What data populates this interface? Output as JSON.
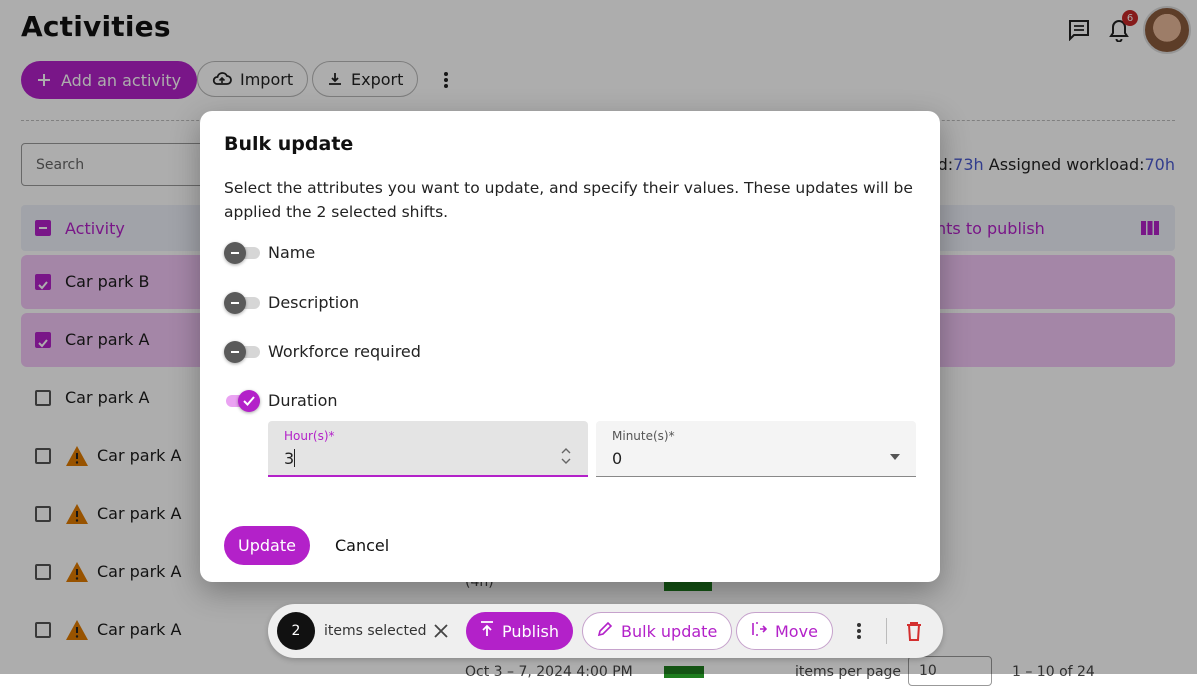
{
  "page": {
    "title": "Activities",
    "add_label": "Add an activity",
    "import_label": "Import",
    "export_label": "Export",
    "notification_count": "6",
    "search_placeholder": "Search",
    "workload_partial": "oad:",
    "workload_partial_value": "73h",
    "assigned_workload_label": "Assigned workload:",
    "assigned_workload_value": "70h",
    "header_activity": "Activity",
    "header_publish_partial": "nts to publish",
    "rows": [
      {
        "label": "Car park B",
        "checked": true,
        "warning": false
      },
      {
        "label": "Car park A",
        "checked": true,
        "warning": false
      },
      {
        "label": "Car park A",
        "checked": false,
        "warning": false
      },
      {
        "label": "Car park A",
        "checked": false,
        "warning": true
      },
      {
        "label": "Car park A",
        "checked": false,
        "warning": true
      },
      {
        "label": "Car park A",
        "checked": false,
        "warning": true
      },
      {
        "label": "Car park A",
        "checked": false,
        "warning": true
      }
    ],
    "partial_duration_text": "(4h)"
  },
  "modal": {
    "title": "Bulk update",
    "description": "Select the attributes you want to update, and specify their values. These updates will be applied the 2 selected shifts.",
    "toggles": [
      {
        "label": "Name",
        "on": false
      },
      {
        "label": "Description",
        "on": false
      },
      {
        "label": "Workforce required",
        "on": false
      },
      {
        "label": "Duration",
        "on": true
      }
    ],
    "hours_label": "Hour(s)*",
    "hours_value": "3",
    "minutes_label": "Minute(s)*",
    "minutes_value": "0",
    "update_label": "Update",
    "cancel_label": "Cancel"
  },
  "selection_bar": {
    "count": "2",
    "items_selected_label": "items selected",
    "publish_label": "Publish",
    "bulk_update_label": "Bulk update",
    "move_label": "Move"
  },
  "footer_partial": {
    "date_text": "Oct 3 – 7, 2024 4:00 PM",
    "items_per_page": "items per page",
    "page_size": "10",
    "range": "1 – 10 of 24"
  },
  "colors": {
    "accent": "#b321c9",
    "selected_row": "#f2c6f7",
    "link_value": "#4b5bd0",
    "warning": "#e07b00",
    "delete": "#d32f2f"
  }
}
